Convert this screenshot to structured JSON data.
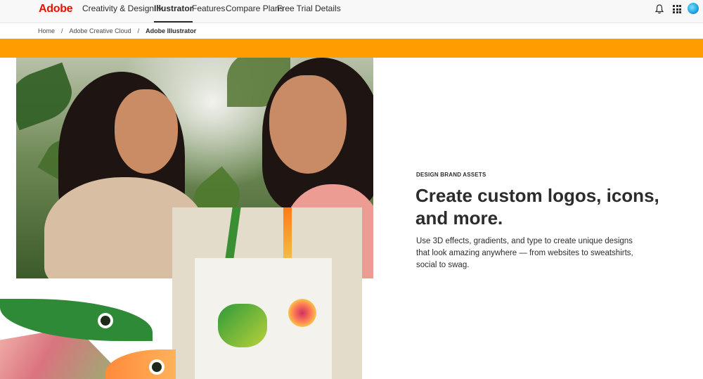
{
  "nav": {
    "logo": "Adobe",
    "items": [
      {
        "label": "Creativity & Design"
      },
      {
        "label": "Illustrator"
      },
      {
        "label": "Features"
      },
      {
        "label": "Compare Plans"
      },
      {
        "label": "Free Trial Details"
      }
    ],
    "active": "Illustrator",
    "icons": [
      "bell-icon",
      "apps-grid-icon",
      "avatar"
    ]
  },
  "breadcrumb": [
    "Home",
    "Adobe Creative Cloud",
    "Adobe Illustrator"
  ],
  "breadcrumb_separator": "/",
  "promo_bar_color": "#ff9c00",
  "hero": {
    "eyebrow": "DESIGN BRAND ASSETS",
    "headline": "Create custom logos, icons, and more.",
    "body": "Use 3D effects, gradients, and type to create unique designs that look amazing anywhere — from websites to sweatshirts, social to swag."
  },
  "colors": {
    "brand": "#eb1000",
    "accent_bar": "#ff9c00",
    "text": "#2c2c2c"
  }
}
